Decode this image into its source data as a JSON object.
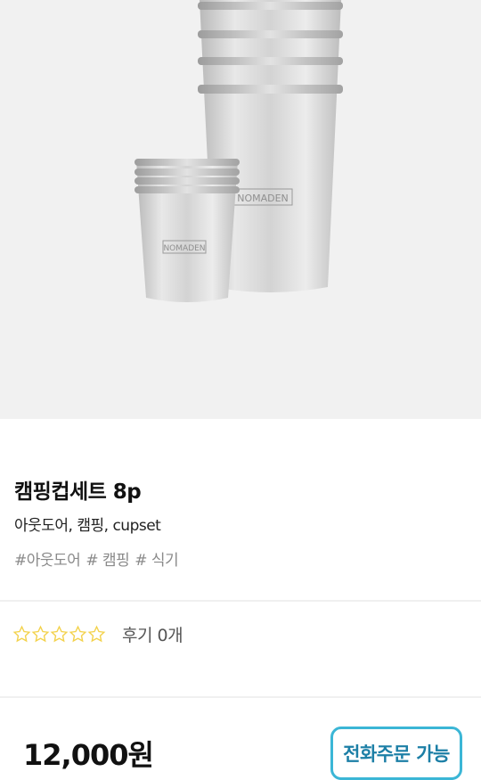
{
  "product": {
    "image_alt_brand": "NOMADEN",
    "name": "캠핑컵세트 8p",
    "description": "아웃도어, 캠핑, cupset",
    "tags": [
      "#아웃도어",
      "# 캠핑",
      "# 식기"
    ]
  },
  "rating": {
    "stars_filled": 0,
    "stars_total": 5,
    "review_label": "후기 0개",
    "star_color": "#f3d24c"
  },
  "purchase": {
    "price": "12,000원",
    "phone_order_label": "전화주문 가능",
    "accent_color": "#3bb6d6"
  }
}
